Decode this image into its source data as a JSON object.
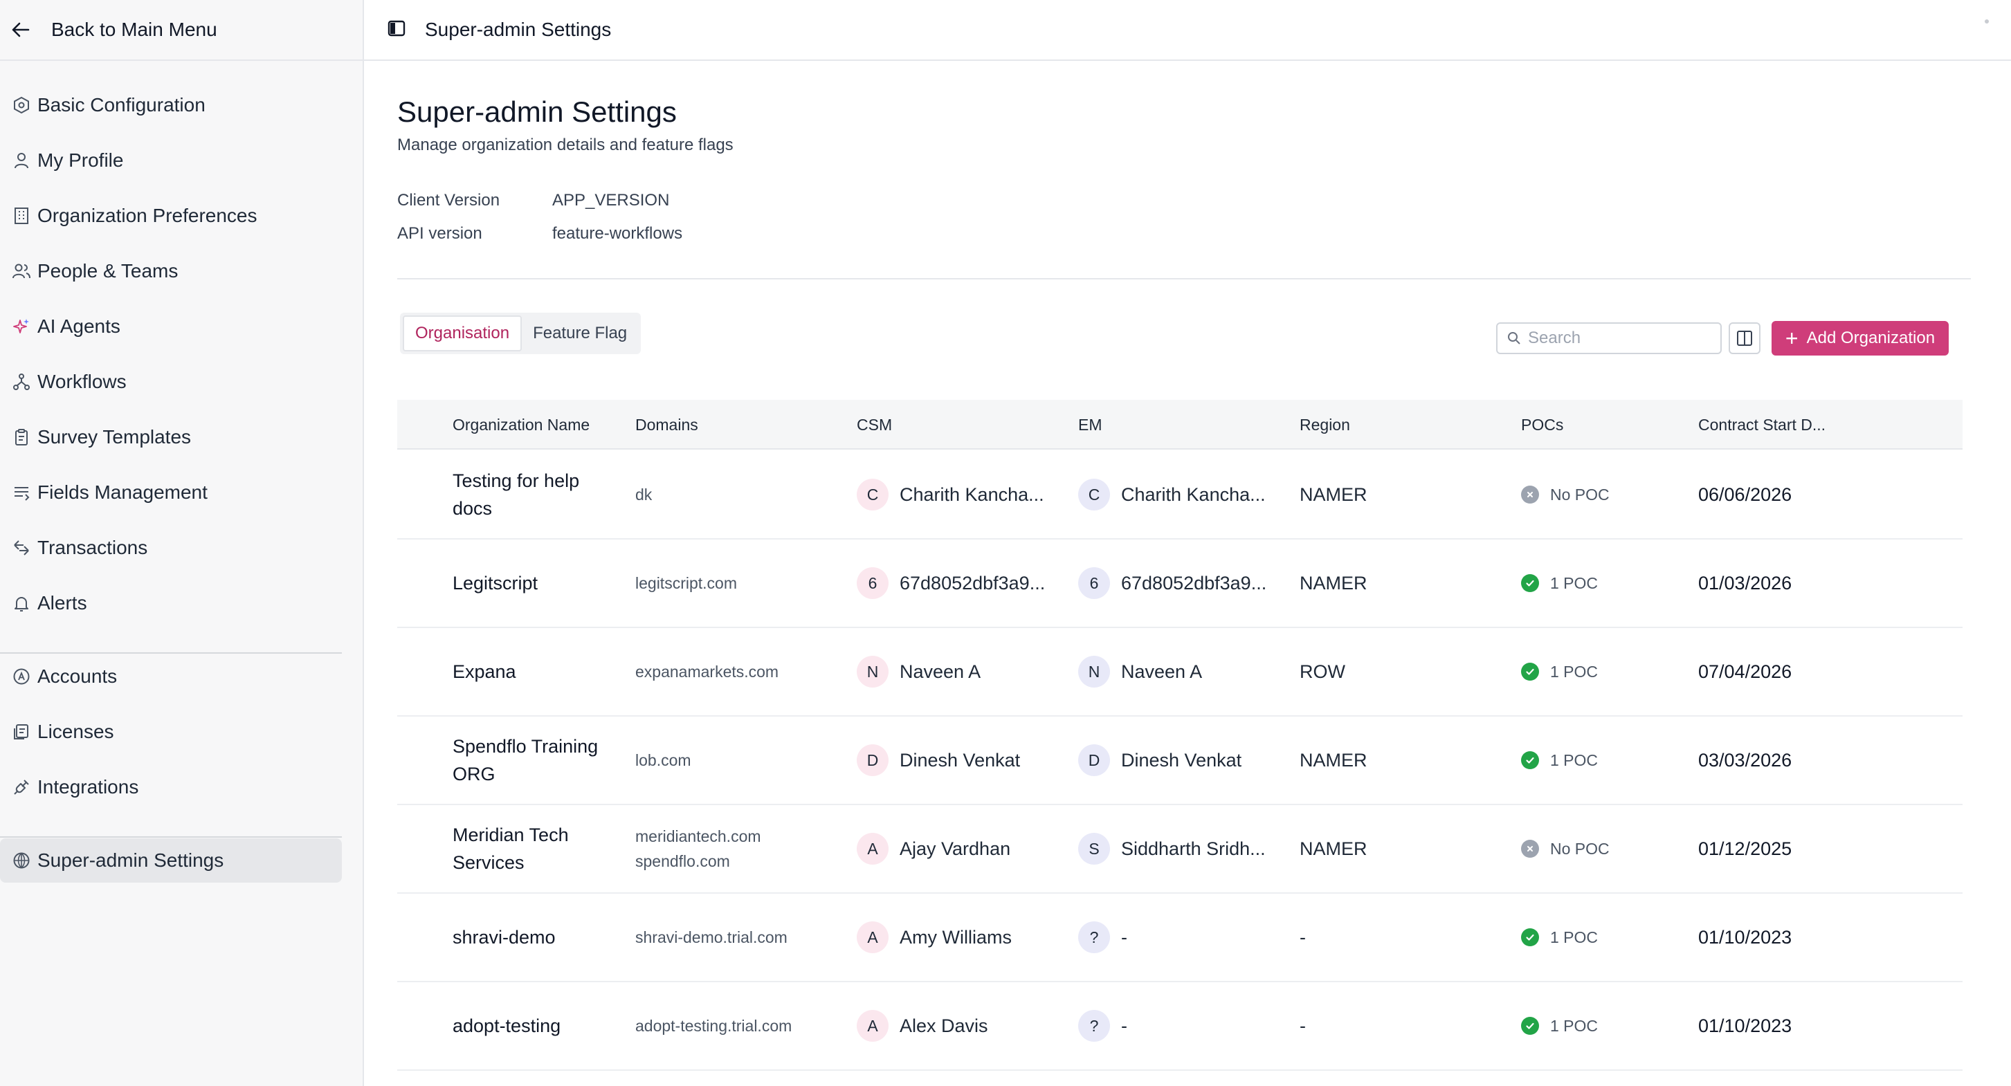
{
  "sidebar": {
    "back_label": "Back to Main Menu",
    "items": [
      {
        "label": "Basic Configuration",
        "icon": "hexagon-settings-icon"
      },
      {
        "label": "My Profile",
        "icon": "user-icon"
      },
      {
        "label": "Organization Preferences",
        "icon": "building-icon"
      },
      {
        "label": "People & Teams",
        "icon": "users-icon"
      },
      {
        "label": "AI Agents",
        "icon": "sparkles-icon"
      },
      {
        "label": "Workflows",
        "icon": "workflow-icon"
      },
      {
        "label": "Survey Templates",
        "icon": "clipboard-icon"
      },
      {
        "label": "Fields Management",
        "icon": "fields-list-icon"
      },
      {
        "label": "Transactions",
        "icon": "transactions-icon"
      },
      {
        "label": "Alerts",
        "icon": "bell-icon"
      }
    ],
    "items2": [
      {
        "label": "Accounts",
        "icon": "accounts-icon"
      },
      {
        "label": "Licenses",
        "icon": "license-icon"
      },
      {
        "label": "Integrations",
        "icon": "plug-icon"
      }
    ],
    "active": {
      "label": "Super-admin Settings",
      "icon": "shield-icon"
    }
  },
  "topbar": {
    "title": "Super-admin Settings"
  },
  "page": {
    "title": "Super-admin Settings",
    "subtitle": "Manage organization details and feature flags",
    "info": [
      {
        "label": "Client Version",
        "value": "APP_VERSION"
      },
      {
        "label": "API version",
        "value": "feature-workflows"
      }
    ]
  },
  "tabs": [
    {
      "label": "Organisation",
      "active": true
    },
    {
      "label": "Feature Flag",
      "active": false
    }
  ],
  "toolbar": {
    "search_placeholder": "Search",
    "add_label": "Add Organization",
    "accent": "#cf3d7a"
  },
  "table": {
    "headers": [
      "Organization Name",
      "Domains",
      "CSM",
      "EM",
      "Region",
      "POCs",
      "Contract Start D..."
    ],
    "rows": [
      {
        "name": "Testing for help docs",
        "domains": [
          "dk"
        ],
        "csm": {
          "initial": "C",
          "name": "Charith Kancha..."
        },
        "em": {
          "initial": "C",
          "name": "Charith Kancha..."
        },
        "region": "NAMER",
        "poc": {
          "ok": false,
          "label": "No POC"
        },
        "date": "06/06/2026"
      },
      {
        "name": "Legitscript",
        "domains": [
          "legitscript.com"
        ],
        "csm": {
          "initial": "6",
          "name": "67d8052dbf3a9..."
        },
        "em": {
          "initial": "6",
          "name": "67d8052dbf3a9..."
        },
        "region": "NAMER",
        "poc": {
          "ok": true,
          "label": "1 POC"
        },
        "date": "01/03/2026"
      },
      {
        "name": "Expana",
        "domains": [
          "expanamarkets.com"
        ],
        "csm": {
          "initial": "N",
          "name": "Naveen A"
        },
        "em": {
          "initial": "N",
          "name": "Naveen A"
        },
        "region": "ROW",
        "poc": {
          "ok": true,
          "label": "1 POC"
        },
        "date": "07/04/2026"
      },
      {
        "name": "Spendflo Training ORG",
        "domains": [
          "lob.com"
        ],
        "csm": {
          "initial": "D",
          "name": "Dinesh Venkat"
        },
        "em": {
          "initial": "D",
          "name": "Dinesh Venkat"
        },
        "region": "NAMER",
        "poc": {
          "ok": true,
          "label": "1 POC"
        },
        "date": "03/03/2026"
      },
      {
        "name": "Meridian Tech Services",
        "domains": [
          "meridiantech.com",
          "spendflo.com"
        ],
        "csm": {
          "initial": "A",
          "name": "Ajay Vardhan"
        },
        "em": {
          "initial": "S",
          "name": "Siddharth Sridh..."
        },
        "region": "NAMER",
        "poc": {
          "ok": false,
          "label": "No POC"
        },
        "date": "01/12/2025"
      },
      {
        "name": "shravi-demo",
        "domains": [
          "shravi-demo.trial.com"
        ],
        "csm": {
          "initial": "A",
          "name": "Amy Williams"
        },
        "em": {
          "initial": "?",
          "name": "-"
        },
        "region": "-",
        "poc": {
          "ok": true,
          "label": "1 POC"
        },
        "date": "01/10/2023"
      },
      {
        "name": "adopt-testing",
        "domains": [
          "adopt-testing.trial.com"
        ],
        "csm": {
          "initial": "A",
          "name": "Alex Davis"
        },
        "em": {
          "initial": "?",
          "name": "-"
        },
        "region": "-",
        "poc": {
          "ok": true,
          "label": "1 POC"
        },
        "date": "01/10/2023"
      }
    ]
  }
}
